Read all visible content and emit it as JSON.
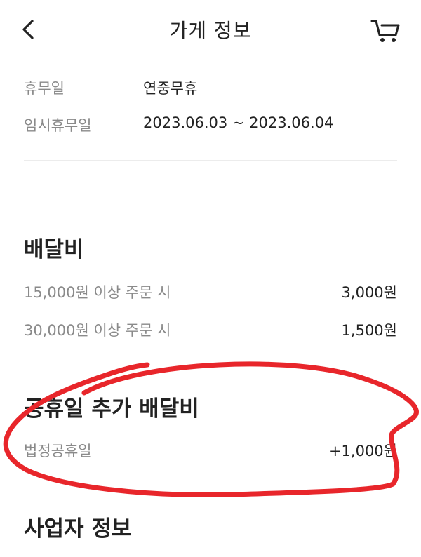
{
  "header": {
    "title": "가게 정보",
    "back_icon": "chevron-left-icon",
    "cart_icon": "cart-icon"
  },
  "holidays": [
    {
      "label": "휴무일",
      "value": "연중무휴"
    },
    {
      "label": "임시휴무일",
      "value": "2023.06.03 ~ 2023.06.04"
    }
  ],
  "delivery_fee": {
    "title": "배달비",
    "rows": [
      {
        "label": "15,000원 이상 주문 시",
        "value": "3,000원"
      },
      {
        "label": "30,000원 이상 주문 시",
        "value": "1,500원"
      }
    ]
  },
  "holiday_fee": {
    "title": "공휴일 추가 배달비",
    "rows": [
      {
        "label": "법정공휴일",
        "value": "+1,000원"
      }
    ]
  },
  "business_info": {
    "title": "사업자 정보"
  },
  "colors": {
    "annotation": "#e8262b",
    "label": "#8a8a8a",
    "text": "#222222"
  }
}
